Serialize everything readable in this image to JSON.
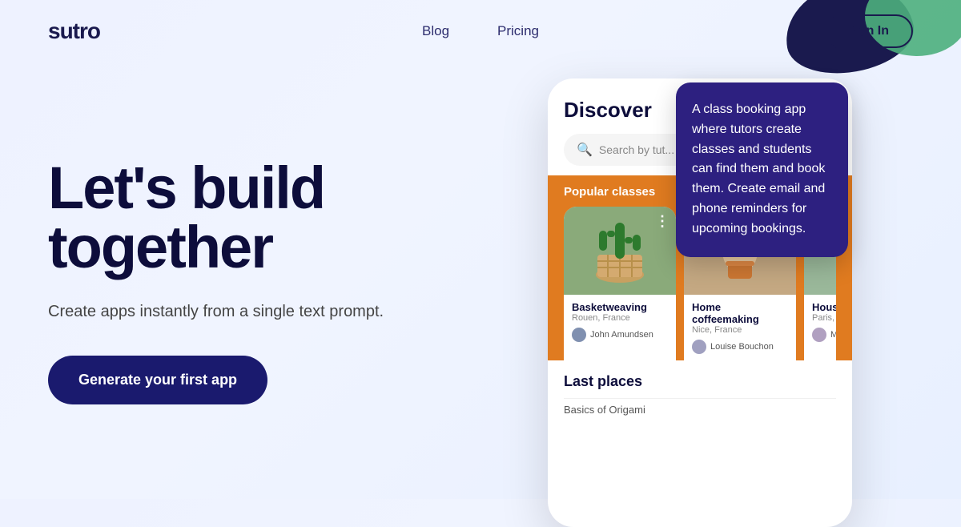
{
  "nav": {
    "logo": "sutro",
    "links": [
      {
        "label": "Blog",
        "href": "#"
      },
      {
        "label": "Pricing",
        "href": "#"
      }
    ],
    "sign_in": "Sign In"
  },
  "hero": {
    "title_line1": "Let's build",
    "title_line2": "together",
    "subtitle": "Create apps instantly from a single text prompt.",
    "cta_label": "Generate your first app"
  },
  "phone": {
    "header": "Discover",
    "search_placeholder": "Search by tut...",
    "popular_label": "Popular classes",
    "cards": [
      {
        "name": "Basketweaving",
        "location": "Rouen, France",
        "author": "John Amundsen",
        "bg_color": "#8aaa7a"
      },
      {
        "name": "Home coffeemaking",
        "location": "Nice, France",
        "author": "Louise Bouchon",
        "bg_color": "#c4a882"
      },
      {
        "name": "Housepla...",
        "location": "Paris, Fran...",
        "author": "Michèle f...",
        "bg_color": "#9ab89a"
      }
    ],
    "last_places_label": "Last places",
    "last_items": [
      {
        "name": "Basics of Origami"
      }
    ]
  },
  "tooltip": {
    "text": "A class booking app where tutors create classes and students can find them and book them. Create email and phone reminders for upcoming bookings."
  },
  "deco": {
    "dark_color": "#1a1a4e",
    "green_color": "#4caf7d"
  }
}
